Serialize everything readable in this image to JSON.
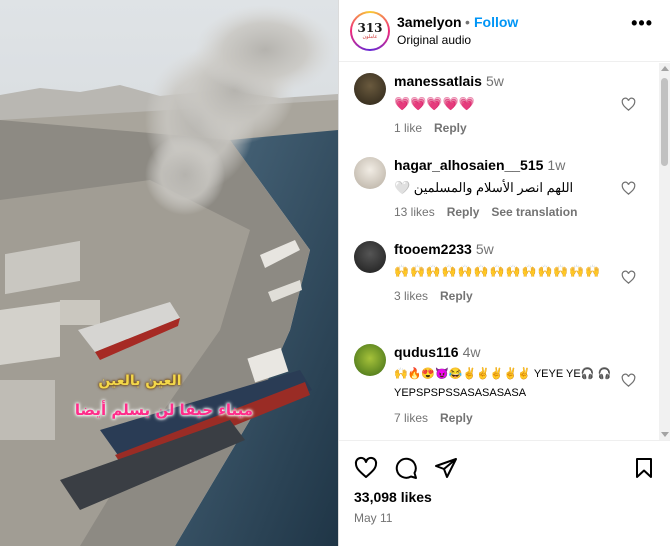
{
  "media": {
    "caption_line1": "العين بالعين",
    "caption_line2": "ميناء حيفا لن يسلم أيضا"
  },
  "header": {
    "username": "3amelyon",
    "separator": "•",
    "follow_label": "Follow",
    "audio_label": "Original audio",
    "avatar_text": "313",
    "avatar_subtext": "عاملون",
    "more_label": "•••"
  },
  "comments": [
    {
      "username": "manessatlais",
      "time": "5w",
      "text": "💗💗💗💗💗",
      "likes": "1 like",
      "reply": "Reply",
      "avatar_icon": "avatar-dark"
    },
    {
      "username": "hagar_alhosaien__515",
      "time": "1w",
      "text": "اللهم انصر الأسلام والمسلمين 🤍",
      "likes": "13 likes",
      "reply": "Reply",
      "translate": "See translation",
      "avatar_icon": "avatar-light"
    },
    {
      "username": "ftooem2233",
      "time": "5w",
      "text": "🙌🙌🙌🙌🙌🙌🙌🙌🙌🙌🙌🙌🙌",
      "likes": "3 likes",
      "reply": "Reply",
      "avatar_icon": "avatar-dark"
    },
    {
      "username": "qudus116",
      "time": "4w",
      "text": "🙌🔥😍😈😂✌✌✌✌✌ YEYE YE🎧 🎧 YEPSPSPSSASASASASA",
      "likes": "7 likes",
      "reply": "Reply",
      "avatar_icon": "avatar-green"
    }
  ],
  "footer": {
    "likes": "33,098 likes",
    "date": "May 11",
    "icons": [
      "heart-icon",
      "comment-icon",
      "share-icon",
      "bookmark-icon"
    ]
  }
}
